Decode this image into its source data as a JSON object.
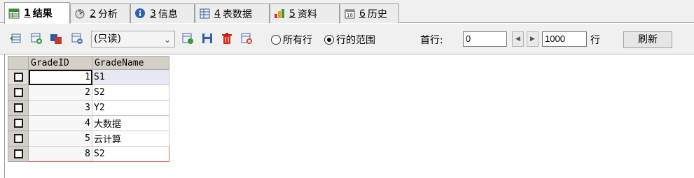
{
  "tabs": [
    {
      "num": "1",
      "label": "结果",
      "icon": "result-table-icon",
      "active": true
    },
    {
      "num": "2",
      "label": "分析",
      "icon": "profiler-icon"
    },
    {
      "num": "3",
      "label": "信息",
      "icon": "info-icon"
    },
    {
      "num": "4",
      "label": "表数据",
      "icon": "table-data-icon"
    },
    {
      "num": "5",
      "label": "资料",
      "icon": "chart-info-icon"
    },
    {
      "num": "6",
      "label": "历史",
      "icon": "history-calendar-icon"
    }
  ],
  "toolbar": {
    "mode_select": "(只读)",
    "radio_all_rows": "所有行",
    "radio_row_range": "行的范围",
    "first_row_label": "首行:",
    "first_row_value": "0",
    "row_count_value": "1000",
    "rows_unit": "行",
    "refresh_label": "刷新"
  },
  "grid": {
    "columns": [
      "GradeID",
      "GradeName"
    ],
    "rows": [
      {
        "id": "1",
        "name": "S1"
      },
      {
        "id": "2",
        "name": "S2"
      },
      {
        "id": "3",
        "name": "Y2"
      },
      {
        "id": "4",
        "name": "大数据"
      },
      {
        "id": "5",
        "name": "云计算"
      },
      {
        "id": "8",
        "name": "S2"
      }
    ]
  },
  "colors": {
    "accent_red": "#e25b5b",
    "header_bg": "#d4d0c8",
    "toolbar_bg": "#f0f0f0"
  }
}
